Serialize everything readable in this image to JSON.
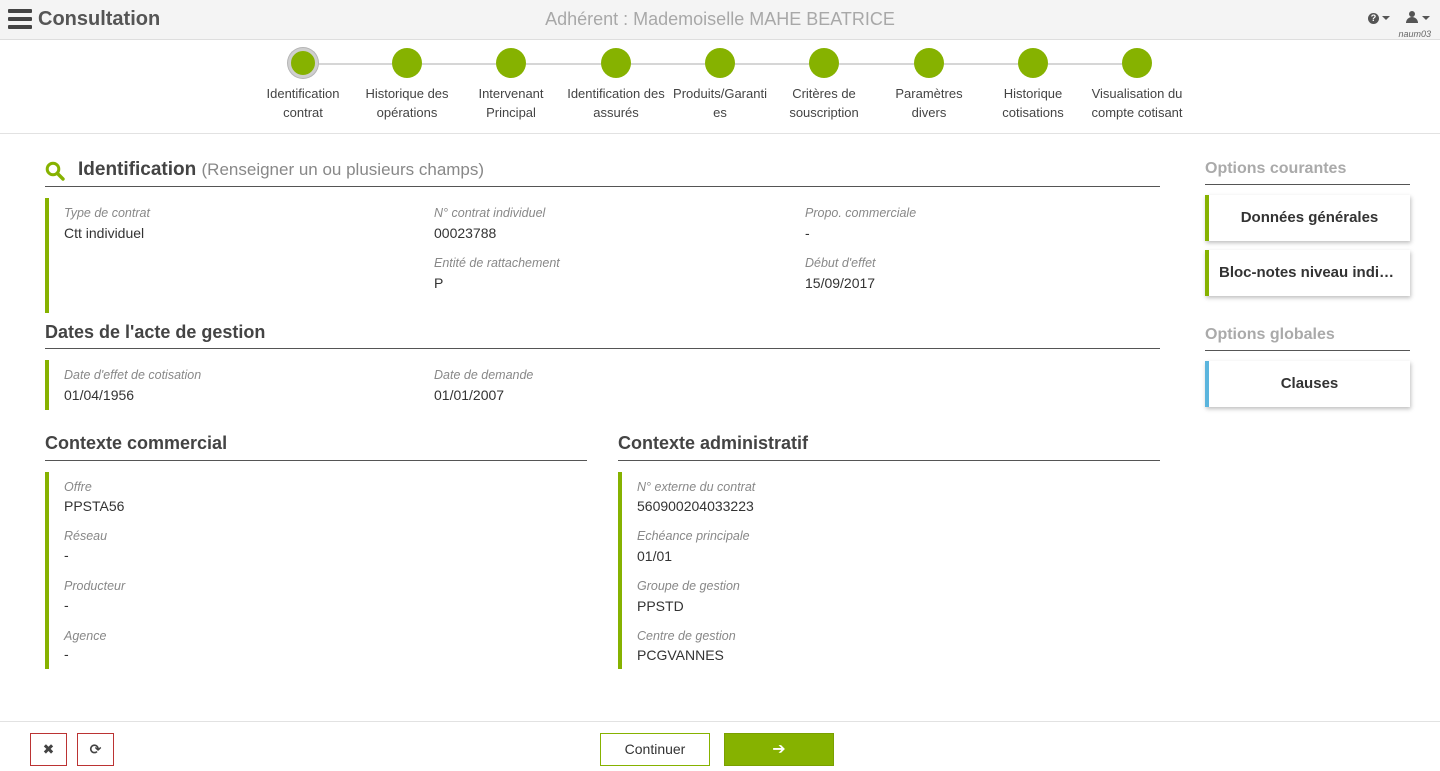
{
  "header": {
    "app_title": "Consultation",
    "member": "Adhérent : Mademoiselle MAHE BEATRICE",
    "help_glyph": "?",
    "username": "naum03"
  },
  "steps": [
    {
      "label_1": "Identification",
      "label_2": "contrat",
      "active": true
    },
    {
      "label_1": "Historique des",
      "label_2": "opérations"
    },
    {
      "label_1": "Intervenant",
      "label_2": "Principal"
    },
    {
      "label_1": "Identification des",
      "label_2": "assurés"
    },
    {
      "label_1": "Produits/Garanti",
      "label_2": "es"
    },
    {
      "label_1": "Critères de",
      "label_2": "souscription"
    },
    {
      "label_1": "Paramètres",
      "label_2": "divers"
    },
    {
      "label_1": "Historique",
      "label_2": "cotisations"
    },
    {
      "label_1": "Visualisation du",
      "label_2": "compte cotisant"
    }
  ],
  "identification": {
    "title": "Identification",
    "subtitle": "(Renseigner un ou plusieurs champs)",
    "type_contrat_label": "Type de contrat",
    "type_contrat_value": "Ctt individuel",
    "num_contrat_label": "N° contrat individuel",
    "num_contrat_value": "00023788",
    "propo_label": "Propo. commerciale",
    "propo_value": "-",
    "entite_label": "Entité de rattachement",
    "entite_value": "P",
    "debut_label": "Début d'effet",
    "debut_value": "15/09/2017"
  },
  "dates": {
    "title": "Dates de l'acte de gestion",
    "effet_cot_label": "Date d'effet de cotisation",
    "effet_cot_value": "01/04/1956",
    "demande_label": "Date de demande",
    "demande_value": "01/01/2007"
  },
  "commercial": {
    "title": "Contexte commercial",
    "offre_label": "Offre",
    "offre_value": "PPSTA56",
    "reseau_label": "Réseau",
    "reseau_value": "-",
    "producteur_label": "Producteur",
    "producteur_value": "-",
    "agence_label": "Agence",
    "agence_value": "-"
  },
  "administratif": {
    "title": "Contexte administratif",
    "ext_label": "N° externe du contrat",
    "ext_value": "560900204033223",
    "echeance_label": "Echéance principale",
    "echeance_value": "01/01",
    "groupe_label": "Groupe de gestion",
    "groupe_value": "PPSTD",
    "centre_label": "Centre de gestion",
    "centre_value": "PCGVANNES"
  },
  "options": {
    "courantes_title": "Options courantes",
    "donnees_label": "Données générales",
    "blocnotes_label": "Bloc-notes niveau indivi...",
    "globales_title": "Options globales",
    "clauses_label": "Clauses"
  },
  "footer": {
    "cancel_glyph": "✖",
    "refresh_glyph": "⟳",
    "continue_label": "Continuer",
    "next_glyph": "➔"
  },
  "colors": {
    "accent": "#86b200",
    "info": "#5bb5dd",
    "danger_border": "#bb3333"
  }
}
